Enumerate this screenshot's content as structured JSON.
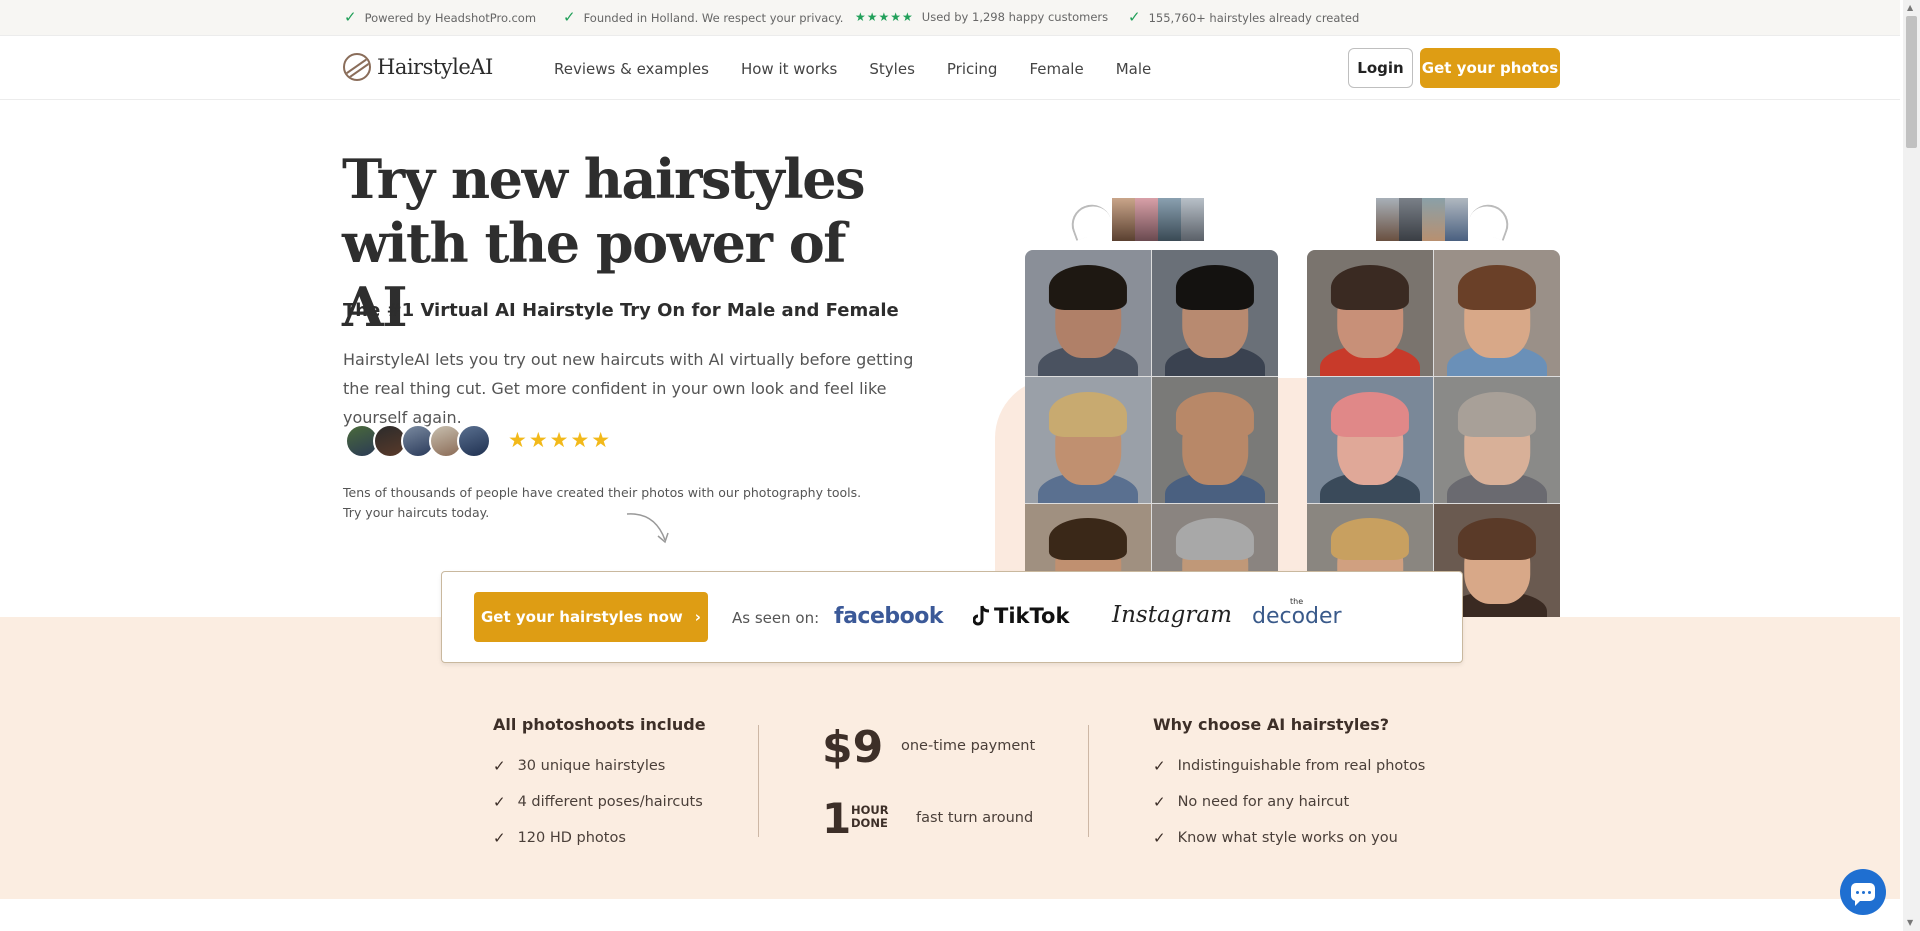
{
  "topbar": {
    "items": [
      {
        "icon": "check-icon",
        "text": "Powered by HeadshotPro.com"
      },
      {
        "icon": "check-icon",
        "text": "Founded in Holland. We respect your privacy."
      },
      {
        "icon": "stars-icon",
        "stars": "★★★★★",
        "text": "Used by 1,298 happy customers"
      },
      {
        "icon": "check-icon",
        "text": "155,760+ hairstyles already created"
      }
    ]
  },
  "header": {
    "logo_text": "HairstyleAI",
    "nav": [
      "Reviews & examples",
      "How it works",
      "Styles",
      "Pricing",
      "Female",
      "Male"
    ],
    "login_label": "Login",
    "cta_label": "Get your photos"
  },
  "hero": {
    "title_line1": "Try new hairstyles",
    "title_line2": "with the power of AI",
    "subtitle": "The #1 Virtual AI Hairstyle Try On for Male and Female",
    "description": "HairstyleAI lets you try out new haircuts with AI virtually before getting the real thing cut. Get more confident in your own look and feel like yourself again.",
    "rating_stars": "★★★★★",
    "note": "Tens of thousands of people have created their photos with our photography tools. Try your haircuts today."
  },
  "seen_on": {
    "cta_label": "Get your hairstyles now",
    "cta_icon": "chevron-right-icon",
    "label": "As seen on:",
    "brands": {
      "facebook": "facebook",
      "tiktok": "TikTok",
      "instagram": "Instagram",
      "decoder": "decoder",
      "decoder_small": "the"
    }
  },
  "features": {
    "left": {
      "title": "All photoshoots include",
      "items": [
        "30 unique hairstyles",
        "4 different poses/haircuts",
        "120 HD photos"
      ]
    },
    "middle": {
      "price": "$9",
      "price_label": "one-time payment",
      "hour_num": "1",
      "hour_word1": "HOUR",
      "hour_word2": "DONE",
      "hour_label": "fast turn around"
    },
    "right": {
      "title": "Why choose AI hairstyles?",
      "items": [
        "Indistinguishable from real photos",
        "No need for any haircut",
        "Know what style works on you"
      ]
    }
  },
  "colors": {
    "accent": "#de9d14",
    "peach": "#fbede1",
    "green_check": "#22a05a",
    "chat_blue": "#1f6fd1"
  }
}
